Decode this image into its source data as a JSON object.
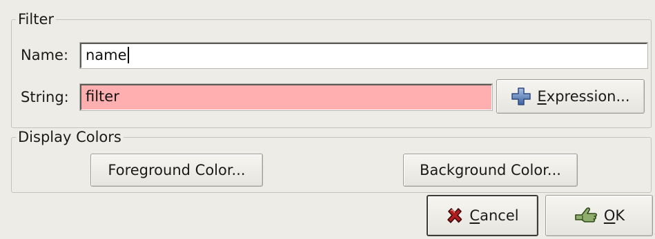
{
  "filter_group": {
    "title": "Filter",
    "name_label": "Name:",
    "name_value": "name",
    "string_label": "String:",
    "string_value": "filter",
    "expression_button": {
      "mnemonic": "E",
      "rest": "xpression..."
    },
    "string_invalid_color": "#ffafaf"
  },
  "colors_group": {
    "title": "Display Colors",
    "foreground_button": "Foreground Color...",
    "background_button": "Background Color..."
  },
  "actions": {
    "cancel": {
      "mnemonic": "C",
      "rest": "ancel"
    },
    "ok": {
      "mnemonic": "O",
      "rest": "K"
    }
  },
  "icons": {
    "expression": "plus-icon",
    "cancel": "cancel-x-icon",
    "ok": "ok-hand-icon"
  }
}
